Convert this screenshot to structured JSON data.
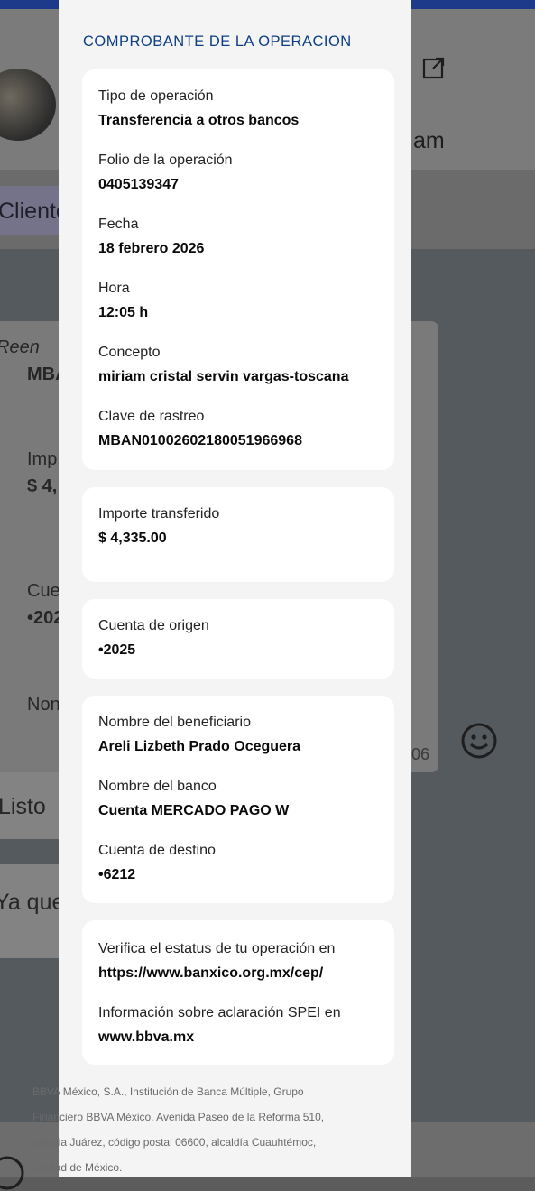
{
  "background": {
    "header_partial_text": "am",
    "chip_partial_text": "Cliente",
    "bubble_left": [
      {
        "text": "Reen"
      },
      {
        "text": "MBA"
      },
      {
        "text": "Imp"
      },
      {
        "text": "$ 4,"
      },
      {
        "text": "Cue"
      },
      {
        "text": "•202"
      },
      {
        "text": "Non"
      }
    ],
    "bubble_right_time": "06",
    "listo_text": "Listo",
    "ya_text": "Ya que"
  },
  "receipt": {
    "title": "COMPROBANTE DE LA OPERACION",
    "operation": {
      "type_label": "Tipo de operación",
      "type_value": "Transferencia a otros bancos",
      "folio_label": "Folio de la operación",
      "folio_value": "0405139347",
      "date_label": "Fecha",
      "date_value": "18 febrero 2026",
      "time_label": "Hora",
      "time_value": "12:05 h",
      "concept_label": "Concepto",
      "concept_value": "miriam cristal servin vargas-toscana",
      "tracking_label": "Clave de rastreo",
      "tracking_value": "MBAN01002602180051966968"
    },
    "amount": {
      "label": "Importe transferido",
      "value": "$ 4,335.00"
    },
    "origin": {
      "label": "Cuenta de origen",
      "value": "•2025"
    },
    "beneficiary": {
      "name_label": "Nombre del beneficiario",
      "name_value": "Areli Lizbeth Prado Oceguera",
      "bank_label": "Nombre del banco",
      "bank_value": "Cuenta MERCADO PAGO W",
      "dest_label": "Cuenta de destino",
      "dest_value": "•6212"
    },
    "info": {
      "verify_label": "Verifica el estatus de tu operación en",
      "verify_value": "https://www.banxico.org.mx/cep/",
      "spei_label": "Información sobre aclaración SPEI en",
      "spei_value": "www.bbva.mx"
    },
    "footer": "BBVA México, S.A., Institución de Banca Múltiple, Grupo Financiero BBVA México. Avenida Paseo de la Reforma 510, colonia Juárez, código postal 06600, alcaldía Cuauhtémoc, Ciudad de México."
  }
}
